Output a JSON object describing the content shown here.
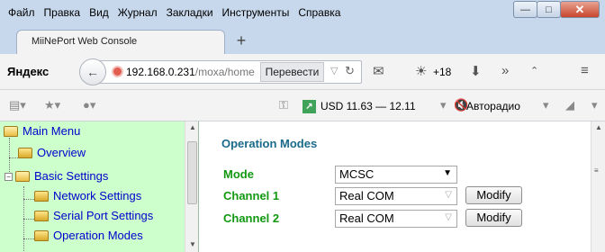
{
  "menu": [
    "Файл",
    "Правка",
    "Вид",
    "Журнал",
    "Закладки",
    "Инструменты",
    "Справка"
  ],
  "window": {
    "minimize": "—",
    "maximize": "□",
    "close": "✕"
  },
  "tab": {
    "title": "MiiNePort Web Console",
    "new_tab": "+"
  },
  "nav": {
    "brand": "Яндекс",
    "url_host": "192.168.0.231",
    "url_path": "/moxa/home",
    "translate_label": "Перевести",
    "weather": "+18"
  },
  "bookmarks": {
    "currency": "USD 11.63 — 12.11",
    "radio": "Авторадио"
  },
  "tree": {
    "root": "Main Menu",
    "items": [
      "Overview",
      "Basic Settings",
      "Network Settings",
      "Serial Port Settings",
      "Operation Modes"
    ]
  },
  "main": {
    "heading": "Operation Modes",
    "mode_label": "Mode",
    "mode_value": "MCSC",
    "channels": [
      {
        "label": "Channel 1",
        "value": "Real COM",
        "button": "Modify"
      },
      {
        "label": "Channel 2",
        "value": "Real COM",
        "button": "Modify"
      }
    ]
  },
  "colors": {
    "tree_bg": "#ccffcc",
    "heading": "#1a6a8a",
    "label": "#119911",
    "link": "#0000cc"
  }
}
